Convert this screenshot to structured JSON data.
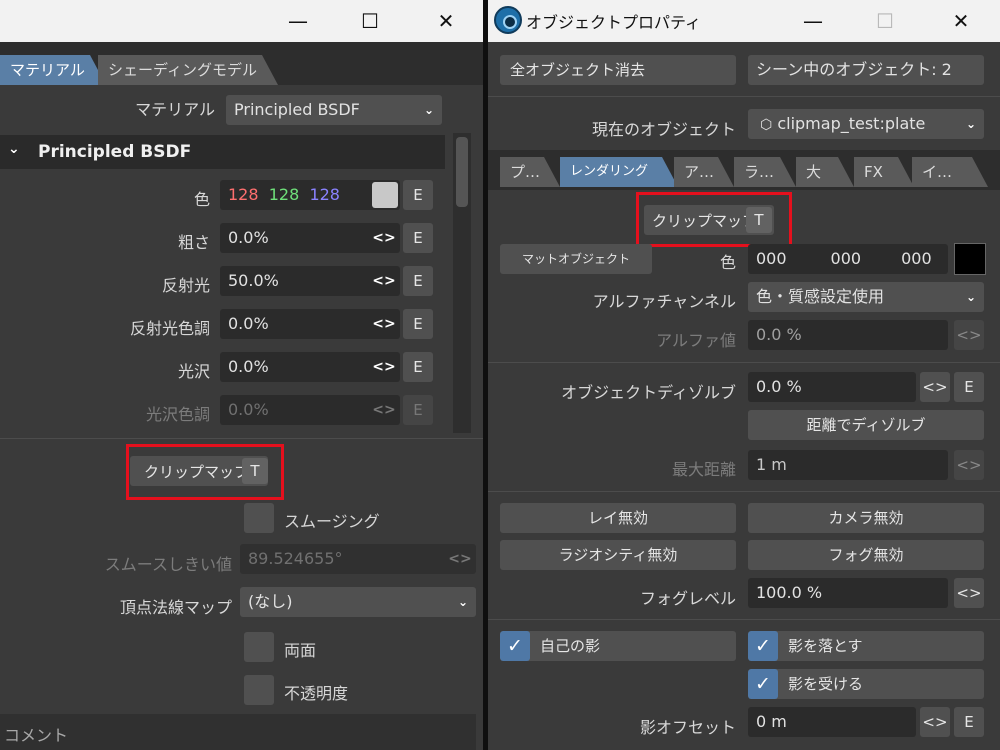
{
  "left": {
    "tabs": [
      "マテリアル",
      "シェーディングモデル"
    ],
    "material_label": "マテリアル",
    "material_value": "Principled BSDF",
    "section_title": "Principled BSDF",
    "color_label": "色",
    "color_r": "128",
    "color_g": "128",
    "color_b": "128",
    "roughness_label": "粗さ",
    "roughness_value": "0.0%",
    "specular_label": "反射光",
    "specular_value": "50.0%",
    "specular_tint_label": "反射光色調",
    "specular_tint_value": "0.0%",
    "sheen_label": "光沢",
    "sheen_value": "0.0%",
    "sheen_tint_label": "光沢色調",
    "sheen_tint_value": "0.0%",
    "e_label": "E",
    "clipmap_label": "クリップマップ",
    "t_label": "T",
    "smoothing_label": "スムージング",
    "smooth_threshold_label": "スムースしきい値",
    "smooth_threshold_value": "89.524655°",
    "vertex_normal_label": "頂点法線マップ",
    "vertex_normal_value": "(なし)",
    "double_sided_label": "両面",
    "opacity_label": "不透明度",
    "comment_label": "コメント"
  },
  "right": {
    "title": "オブジェクトプロパティ",
    "clear_all": "全オブジェクト消去",
    "scene_objects": "シーン中のオブジェクト: 2",
    "current_object_label": "現在のオブジェクト",
    "current_object_value": "clipmap_test:plate",
    "tabs": [
      "プ…",
      "レンダリング",
      "ア…",
      "ラ…",
      "大",
      "FX",
      "イ…"
    ],
    "clipmap_label": "クリップマップ",
    "t_label": "T",
    "matte_object": "マットオブジェクト",
    "color_label": "色",
    "color_r": "000",
    "color_g": "000",
    "color_b": "000",
    "alpha_channel_label": "アルファチャンネル",
    "alpha_channel_value": "色・質感設定使用",
    "alpha_value_label": "アルファ値",
    "alpha_value": "0.0 %",
    "dissolve_label": "オブジェクトディゾルブ",
    "dissolve_value": "0.0 %",
    "distance_dissolve": "距離でディゾルブ",
    "max_distance_label": "最大距離",
    "max_distance_value": "1 m",
    "ray_off": "レイ無効",
    "camera_off": "カメラ無効",
    "radiosity_off": "ラジオシティ無効",
    "fog_off": "フォグ無効",
    "fog_level_label": "フォグレベル",
    "fog_level_value": "100.0 %",
    "self_shadow": "自己の影",
    "cast_shadow": "影を落とす",
    "receive_shadow": "影を受ける",
    "shadow_offset_label": "影オフセット",
    "shadow_offset_value": "0 m",
    "e_label": "E"
  },
  "colors": {
    "accent": "#5a7fa6",
    "highlight": "#e5101d",
    "red": "#ff6f6f",
    "green": "#6fe07a",
    "blue": "#8a82ff"
  },
  "icons": [
    "minimize-icon",
    "maximize-icon",
    "close-icon",
    "chevron-down-icon",
    "arrows-icon",
    "check-icon",
    "cube-icon",
    "app-logo-icon"
  ]
}
